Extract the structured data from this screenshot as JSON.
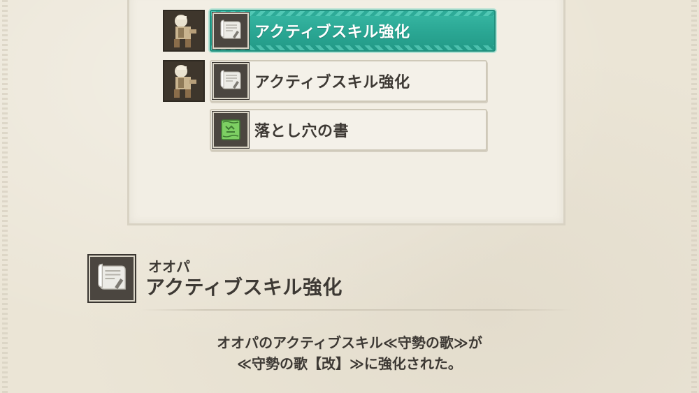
{
  "skill_list": {
    "items": [
      {
        "label": "アクティブスキル強化",
        "icon": "skill-scroll-icon",
        "has_avatar": true,
        "avatar": "ooopa-avatar",
        "selected": true
      },
      {
        "label": "アクティブスキル強化",
        "icon": "skill-scroll-icon",
        "has_avatar": true,
        "avatar": "ooopa-avatar",
        "selected": false
      },
      {
        "label": "落とし穴の書",
        "icon": "green-trap-book-icon",
        "has_avatar": false,
        "selected": false
      }
    ]
  },
  "detail": {
    "owner": "オオパ",
    "title": "アクティブスキル強化",
    "icon": "skill-scroll-icon",
    "description_line1": "オオパのアクティブスキル≪守勢の歌≫が",
    "description_line2": "≪守勢の歌【改】≫に強化された。"
  },
  "colors": {
    "selected": "#2aa693",
    "paper": "#ebe5d6",
    "text": "#3d3934",
    "trap_book": "#6fbf5a"
  }
}
